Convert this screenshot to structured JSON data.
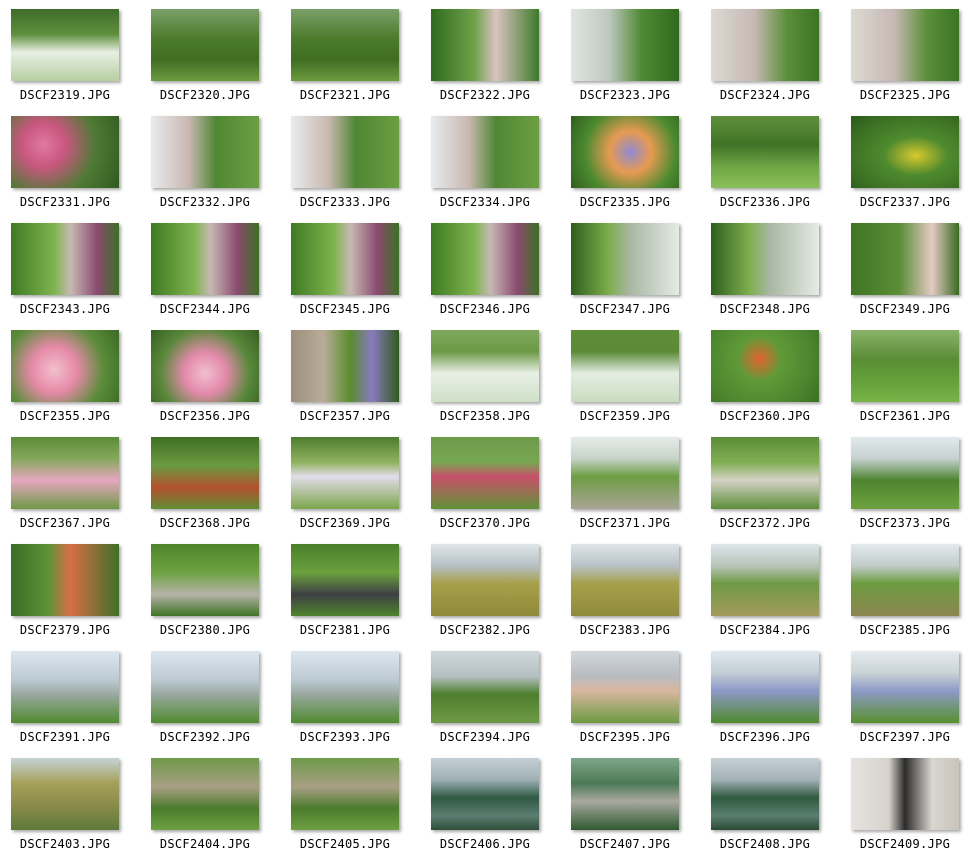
{
  "window": {
    "background": "#ffffff"
  },
  "thumbnails": [
    {
      "label": "DSCF2319.JPG",
      "bg": "linear-gradient(180deg,#3e6b2a 0%,#5f8f3c 35%,#e8efe3 60%,#b7cfa3 100%)"
    },
    {
      "label": "DSCF2320.JPG",
      "bg": "linear-gradient(180deg,#7aa06a 0%,#4d7c2d 40%,#3f6e23 70%,#6b9a3e 100%)"
    },
    {
      "label": "DSCF2321.JPG",
      "bg": "linear-gradient(180deg,#7aa06a 0%,#4d7c2d 40%,#3f6e23 70%,#6b9a3e 100%)"
    },
    {
      "label": "DSCF2322.JPG",
      "bg": "linear-gradient(90deg,#2f6a1e 0%,#6fa14a 40%,#d9c3c0 60%,#3e7a2a 100%)"
    },
    {
      "label": "DSCF2323.JPG",
      "bg": "linear-gradient(90deg,#dfe6e0 0%,#bfc8c0 35%,#4f8a34 65%,#2f6a1e 100%)"
    },
    {
      "label": "DSCF2324.JPG",
      "bg": "linear-gradient(90deg,#dcdad2 0%,#c7b8b4 40%,#5b8f3a 70%,#3a7424 100%)"
    },
    {
      "label": "DSCF2325.JPG",
      "bg": "linear-gradient(90deg,#dcdad2 0%,#c7b8b4 40%,#5b8f3a 70%,#3a7424 100%)"
    },
    {
      "label": "DSCF2331.JPG",
      "bg": "radial-gradient(circle at 30% 40%,#e07aa0 0%,#c9577f 25%,#4f7a35 60%,#2f5a1e 100%)"
    },
    {
      "label": "DSCF2332.JPG",
      "bg": "linear-gradient(90deg,#e8ecef 0%,#c9b7b0 35%,#4f8734 60%,#6c9f42 100%)"
    },
    {
      "label": "DSCF2333.JPG",
      "bg": "linear-gradient(90deg,#e8ecef 0%,#c9b7b0 35%,#4f8734 60%,#6c9f42 100%)"
    },
    {
      "label": "DSCF2334.JPG",
      "bg": "linear-gradient(90deg,#e8ecef 0%,#c9b7b0 35%,#4f8734 60%,#6c9f42 100%)"
    },
    {
      "label": "DSCF2335.JPG",
      "bg": "radial-gradient(circle at 55% 50%,#8f8ad0 0%,#e79a52 30%,#4c8a30 65%,#2f5e1f 100%)"
    },
    {
      "label": "DSCF2336.JPG",
      "bg": "linear-gradient(180deg,#5f8f3b 0%,#3f7326 40%,#6ea645 70%,#8bbf5a 100%)"
    },
    {
      "label": "DSCF2337.JPG",
      "bg": "radial-gradient(ellipse at 60% 55%,#d9c92e 0%,#4e8a2e 35%,#3d7224 70%,#2a5a1c 100%)"
    },
    {
      "label": "DSCF2343.JPG",
      "bg": "linear-gradient(90deg,#3e7a22 0%,#7fb44f 40%,#c7b9b2 55%,#8a4a70 80%,#3c6f25 100%)"
    },
    {
      "label": "DSCF2344.JPG",
      "bg": "linear-gradient(90deg,#3e7a22 0%,#7fb44f 40%,#c7b9b2 55%,#8a4a70 80%,#3c6f25 100%)"
    },
    {
      "label": "DSCF2345.JPG",
      "bg": "linear-gradient(90deg,#3e7a22 0%,#7fb44f 40%,#c7b9b2 55%,#8a4a70 80%,#3c6f25 100%)"
    },
    {
      "label": "DSCF2346.JPG",
      "bg": "linear-gradient(90deg,#3e7a22 0%,#7fb44f 40%,#c7b9b2 55%,#8a4a70 80%,#3c6f25 100%)"
    },
    {
      "label": "DSCF2347.JPG",
      "bg": "linear-gradient(90deg,#2f5e1e 0%,#7cae4c 35%,#a9b7a4 55%,#e4ece4 100%)"
    },
    {
      "label": "DSCF2348.JPG",
      "bg": "linear-gradient(90deg,#2f5e1e 0%,#7cae4c 35%,#a9b7a4 55%,#e4ece4 100%)"
    },
    {
      "label": "DSCF2349.JPG",
      "bg": "linear-gradient(90deg,#3e7424 0%,#5b8e35 45%,#e3c9c4 75%,#3a6b22 100%)"
    },
    {
      "label": "DSCF2355.JPG",
      "bg": "radial-gradient(circle at 40% 55%,#f2c0cf 0%,#e68aa8 30%,#5b8c3a 65%,#3b6a24 100%)"
    },
    {
      "label": "DSCF2356.JPG",
      "bg": "radial-gradient(circle at 50% 60%,#f1bfd0 0%,#e38aaa 30%,#58883a 65%,#375f22 100%)"
    },
    {
      "label": "DSCF2357.JPG",
      "bg": "linear-gradient(90deg,#9c8f7d 0%,#b8ac98 30%,#5a8c2e 55%,#8a7ac0 75%,#2f5a1e 100%)"
    },
    {
      "label": "DSCF2358.JPG",
      "bg": "linear-gradient(180deg,#7fa85d 0%,#6c9a45 30%,#e8efe6 60%,#cfe0c6 100%)"
    },
    {
      "label": "DSCF2359.JPG",
      "bg": "linear-gradient(180deg,#5f8e39 0%,#5b8a36 30%,#e4ede2 60%,#c9dcc0 100%)"
    },
    {
      "label": "DSCF2360.JPG",
      "bg": "radial-gradient(circle at 45% 40%,#e2632e 0%,#5f9a38 30%,#4c852e 70%,#3b6f22 100%)"
    },
    {
      "label": "DSCF2361.JPG",
      "bg": "linear-gradient(180deg,#8ab36a 0%,#5a8d35 40%,#63a03a 70%,#7ab449 100%)"
    },
    {
      "label": "DSCF2367.JPG",
      "bg": "linear-gradient(180deg,#5d8b38 0%,#83a85a 30%,#e6a7c0 60%,#6e9a45 100%)"
    },
    {
      "label": "DSCF2368.JPG",
      "bg": "linear-gradient(180deg,#3f6f24 0%,#6a9a40 40%,#b3502e 70%,#5f8f35 100%)"
    },
    {
      "label": "DSCF2369.JPG",
      "bg": "linear-gradient(180deg,#4f7c2f 0%,#8fb25f 35%,#e3dcea 55%,#7ba64b 100%)"
    },
    {
      "label": "DSCF2370.JPG",
      "bg": "linear-gradient(180deg,#6e9a4a 0%,#78a752 35%,#c7506a 55%,#5f9337 100%)"
    },
    {
      "label": "DSCF2371.JPG",
      "bg": "linear-gradient(180deg,#e6ecea 0%,#c7d3c7 30%,#6d9d43 55%,#a9a596 100%)"
    },
    {
      "label": "DSCF2372.JPG",
      "bg": "linear-gradient(180deg,#5b8c37 0%,#7fae52 35%,#d4d2c6 60%,#5c8d38 100%)"
    },
    {
      "label": "DSCF2373.JPG",
      "bg": "linear-gradient(180deg,#e2e9ec 0%,#c5d1cf 30%,#4e8430 60%,#6da33f 100%)"
    },
    {
      "label": "DSCF2379.JPG",
      "bg": "linear-gradient(90deg,#3a6d25 0%,#5f9338 35%,#d86e45 55%,#3c7026 100%)"
    },
    {
      "label": "DSCF2380.JPG",
      "bg": "linear-gradient(180deg,#4f852b 0%,#6ea242 40%,#b6b2a8 70%,#3f7326 100%)"
    },
    {
      "label": "DSCF2381.JPG",
      "bg": "linear-gradient(180deg,#4a7f2b 0%,#6aa03e 40%,#3e3f44 70%,#4f842d 100%)"
    },
    {
      "label": "DSCF2382.JPG",
      "bg": "linear-gradient(180deg,#dfe6ea 0%,#b7c0c4 30%,#a7a04a 55%,#8f8a3a 100%)"
    },
    {
      "label": "DSCF2383.JPG",
      "bg": "linear-gradient(180deg,#dfe6ea 0%,#b9c2c6 30%,#a5a04a 55%,#8f8b3d 100%)"
    },
    {
      "label": "DSCF2384.JPG",
      "bg": "linear-gradient(180deg,#dfe7ea 0%,#b8c4b9 30%,#6f9a45 55%,#a39a5c 100%)"
    },
    {
      "label": "DSCF2385.JPG",
      "bg": "linear-gradient(180deg,#e3eaee 0%,#c2ccc8 30%,#6c9c40 55%,#8c8550 100%)"
    },
    {
      "label": "DSCF2391.JPG",
      "bg": "linear-gradient(180deg,#dde7ee 0%,#bccad3 40%,#9aa9a0 60%,#4f8a30 100%)"
    },
    {
      "label": "DSCF2392.JPG",
      "bg": "linear-gradient(180deg,#dde7ee 0%,#bccad3 40%,#9aa9a0 60%,#4f8a30 100%)"
    },
    {
      "label": "DSCF2393.JPG",
      "bg": "linear-gradient(180deg,#dde7ee 0%,#bccad3 40%,#9aa9a0 60%,#4f8a30 100%)"
    },
    {
      "label": "DSCF2394.JPG",
      "bg": "linear-gradient(180deg,#cfd8db 0%,#b5c0c2 35%,#4e7f2e 60%,#6f9a45 100%)"
    },
    {
      "label": "DSCF2395.JPG",
      "bg": "linear-gradient(180deg,#d2d8dc 0%,#b8bcc0 35%,#d9b7a0 55%,#6d9a42 100%)"
    },
    {
      "label": "DSCF2396.JPG",
      "bg": "linear-gradient(180deg,#dfe8ee 0%,#c2cfd5 30%,#8e98c8 55%,#4f8a2f 100%)"
    },
    {
      "label": "DSCF2397.JPG",
      "bg": "linear-gradient(180deg,#e6ecef 0%,#cad3d6 30%,#8f9ac8 55%,#57902f 100%)"
    },
    {
      "label": "DSCF2403.JPG",
      "bg": "linear-gradient(180deg,#c6d3d6 0%,#a4a05a 35%,#8b8c4a 65%,#5e7a3a 100%)"
    },
    {
      "label": "DSCF2404.JPG",
      "bg": "linear-gradient(180deg,#6f9a4a 0%,#a99f84 40%,#4a7c2c 70%,#6ea043 100%)"
    },
    {
      "label": "DSCF2405.JPG",
      "bg": "linear-gradient(180deg,#6f9a4a 0%,#a99f84 40%,#4a7c2c 70%,#6ea043 100%)"
    },
    {
      "label": "DSCF2406.JPG",
      "bg": "linear-gradient(180deg,#c5cfd6 0%,#9fb0b5 30%,#2f5a44 55%,#5b7c70 80%,#2f4e3a 100%)"
    },
    {
      "label": "DSCF2407.JPG",
      "bg": "linear-gradient(180deg,#7fa68a 0%,#4c7a55 35%,#a9a8a0 60%,#2f5a30 100%)"
    },
    {
      "label": "DSCF2408.JPG",
      "bg": "linear-gradient(180deg,#c7d1d6 0%,#a3b2b7 30%,#2e5a3e 55%,#5a7d70 80%,#2b4a34 100%)"
    },
    {
      "label": "DSCF2409.JPG",
      "bg": "linear-gradient(90deg,#e6e3df 0%,#d7d2cc 35%,#2b2b2b 50%,#d9d6d0 75%,#c9c4bc 100%)"
    }
  ]
}
